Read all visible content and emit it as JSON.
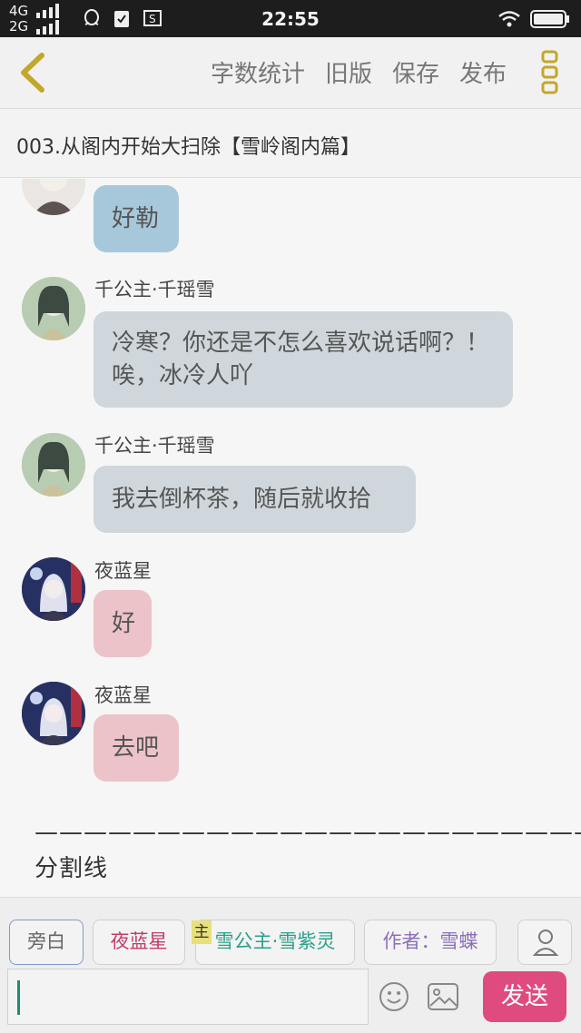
{
  "status_bar": {
    "net_top": "4G",
    "net_bottom": "2G",
    "time": "22:55",
    "icons": [
      "signal-icon",
      "qq-icon",
      "clipboard-icon",
      "sim-icon",
      "wifi-icon",
      "battery-icon"
    ]
  },
  "toolbar": {
    "back_icon": "chevron-left-icon",
    "actions": [
      "字数统计",
      "旧版",
      "保存",
      "发布"
    ],
    "more_icon": "more-vertical-icon",
    "accent": "#c2a72a"
  },
  "chapter": {
    "title": "003.从阁内开始大扫除【雪岭阁内篇】"
  },
  "messages": [
    {
      "name": "",
      "text": "好勒",
      "color": "#a7c8da"
    },
    {
      "name": "千公主·千瑶雪",
      "text": "冷寒？你还是不怎么喜欢说话啊？！唉，冰冷人吖",
      "color": "#cfd7dc"
    },
    {
      "name": "千公主·千瑶雪",
      "text": "我去倒杯茶，随后就收拾",
      "color": "#cfd7dc"
    },
    {
      "name": "夜蓝星",
      "text": "好",
      "color": "#ecc3c8"
    },
    {
      "name": "夜蓝星",
      "text": "去吧",
      "color": "#ecc3c8"
    }
  ],
  "divider": {
    "text": "————————————————————————————————————————分割线"
  },
  "roles": {
    "items": [
      {
        "label": "旁白",
        "color": "#555555"
      },
      {
        "label": "夜蓝星",
        "color": "#c23c6a"
      },
      {
        "label": "雪公主·雪紫灵",
        "color": "#2aa08a"
      },
      {
        "label": "作者：雪蝶",
        "color": "#8a6fb8"
      }
    ],
    "owner_badge": "主"
  },
  "input": {
    "value": "",
    "send_label": "发送",
    "send_color": "#df4b7e"
  }
}
